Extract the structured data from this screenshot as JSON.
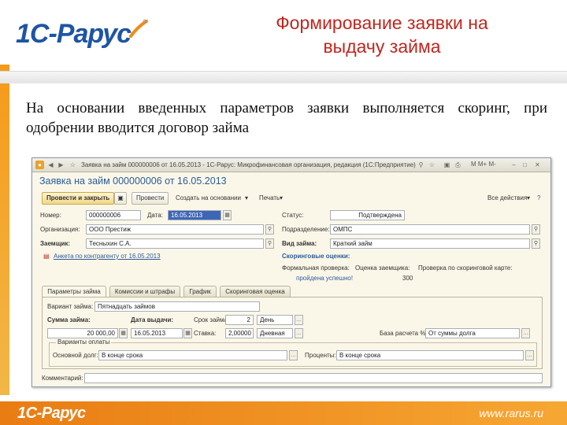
{
  "slide": {
    "logo_text": "1С-Рарус",
    "title_line1": "Формирование заявки на",
    "title_line2": "выдачу займа",
    "body_text": "На основании введенных параметров заявки выполняется скоринг, при одобрении вводится договор займа",
    "footer_logo": "1С-Рарус",
    "footer_url": "www.rarus.ru",
    "colors": {
      "title": "#c0261f",
      "logo": "#1e55a5",
      "footer": "#e97c13",
      "stripe": "#f59a1a"
    }
  },
  "window": {
    "title": "Заявка на займ 000000006 от 16.05.2013 - 1С-Рарус: Микрофинансовая организация, редакция (1С:Предприятие)",
    "titlebar_right": "M  M+  M-",
    "form_title": "Заявка на займ 000000006 от 16.05.2013",
    "toolbar": {
      "post_close": "Провести и закрыть",
      "post": "Провести",
      "create_based": "Создать на основании",
      "print": "Печать",
      "all_actions": "Все действия"
    },
    "header": {
      "number_label": "Номер:",
      "number_value": "000000006",
      "date_label": "Дата:",
      "date_value": "16.05.2013",
      "status_label": "Статус:",
      "status_value": "Подтверждена",
      "org_label": "Организация:",
      "org_value": "ООО Престиж",
      "division_label": "Подразделение:",
      "division_value": "ОМПС",
      "borrower_label": "Заемщик:",
      "borrower_value": "Тесныхин С.А.",
      "loan_type_label": "Вид займа:",
      "loan_type_value": "Краткий займ",
      "anketa_link": "Анкета по контрагенту от 16.05.2013"
    },
    "scoring": {
      "heading": "Скоринговые оценки:",
      "col1": "Формальная проверка:",
      "col2": "Оценка заемщика:",
      "col3": "Проверка по скоринговой карте:",
      "result_text": "пройдена успешно!",
      "score": "300"
    },
    "tabs": [
      "Параметры займа",
      "Комиссии и штрафы",
      "График",
      "Скоринговая оценка"
    ],
    "params": {
      "variant_label": "Вариант займа:",
      "variant_value": "Пятнадцать займов",
      "sum_label": "Сумма займа:",
      "sum_value": "20 000,00",
      "issue_date_label": "Дата выдачи:",
      "issue_date_value": "16.05.2013",
      "term_label": "Срок займа:",
      "term_value": "2",
      "term_unit": "День",
      "rate_label": "Ставка:",
      "rate_value": "2,00000",
      "rate_type": "Дневная",
      "base_label": "База расчета %:",
      "base_value": "От суммы долга",
      "repay_group": "Варианты оплаты",
      "principal_label": "Основной долг:",
      "principal_value": "В конце срока",
      "interest_label": "Проценты:",
      "interest_value": "В конце срока"
    },
    "comment_label": "Комментарий:"
  }
}
